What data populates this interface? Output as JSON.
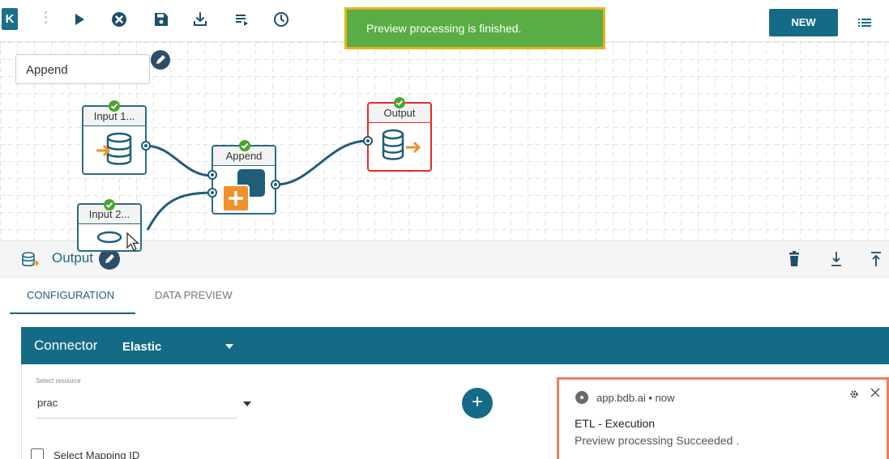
{
  "toolbar": {
    "logo": "K",
    "new_label": "NEW"
  },
  "toast": {
    "message": "Preview processing is finished."
  },
  "pipeline": {
    "name": "Append",
    "nodes": {
      "input1": {
        "label": "Input 1..."
      },
      "input2": {
        "label": "Input 2..."
      },
      "append": {
        "label": "Append"
      },
      "output": {
        "label": "Output"
      }
    }
  },
  "panel": {
    "title": "Output",
    "tabs": [
      {
        "label": "CONFIGURATION"
      },
      {
        "label": "DATA PREVIEW"
      }
    ]
  },
  "config": {
    "connector_label": "Connector",
    "connector_value": "Elastic",
    "resource_label": "Select resource",
    "resource_value": "prac",
    "add_label": "+",
    "mapping_label": "Select Mapping ID"
  },
  "notification": {
    "source": "app.bdb.ai",
    "separator": "•",
    "time": "now",
    "title": "ETL - Execution",
    "message": "Preview processing Succeeded ."
  },
  "colors": {
    "primary": "#156b87",
    "success": "#5aac44",
    "toast_border": "#e6b321",
    "error": "#e52a2a",
    "accent_orange": "#f0922b",
    "notification_border": "#e8825a"
  }
}
